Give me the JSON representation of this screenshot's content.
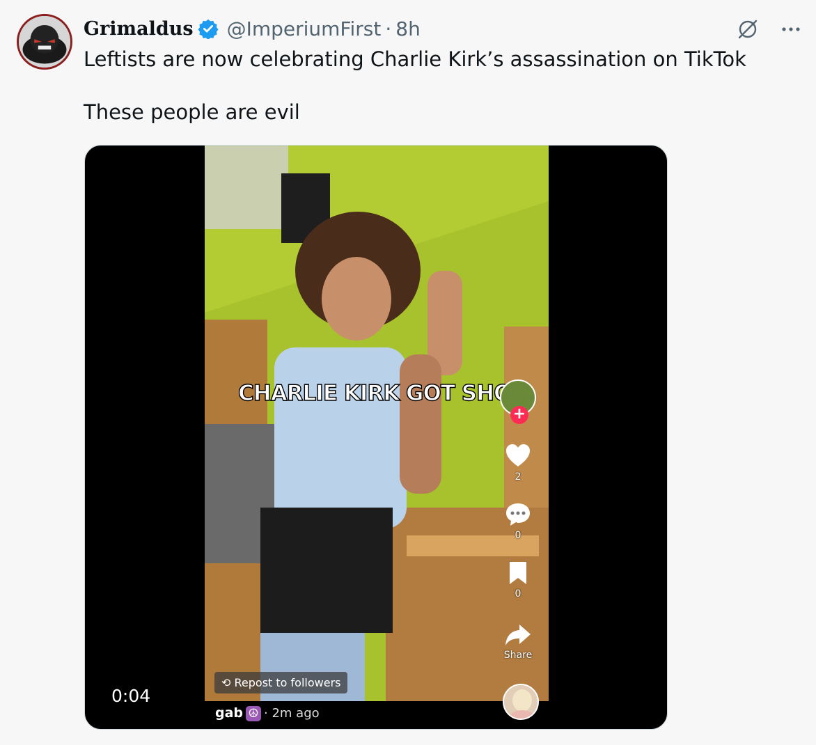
{
  "tweet": {
    "author_name": "Grimaldus",
    "handle": "@ImperiumFirst",
    "separator": "·",
    "time": "8h",
    "verified_icon": "verified-badge-icon",
    "text_line1": "Leftists are now celebrating Charlie Kirk’s assassination on TikTok",
    "text_line2": "These people are evil"
  },
  "media": {
    "duration": "0:04",
    "caption": "CHARLIE KIRK GOT SHOT",
    "likes": "2",
    "comments": "0",
    "bookmarks": "0",
    "share_label": "Share",
    "repost_label": "Repost to followers",
    "source_name": "gab",
    "source_ago": "· 2m ago"
  },
  "colors": {
    "accent_blue": "#1d9bf0",
    "muted_text": "#536471",
    "tiktok_red": "#fe2c55",
    "avatar_border": "#8b1e1e"
  }
}
